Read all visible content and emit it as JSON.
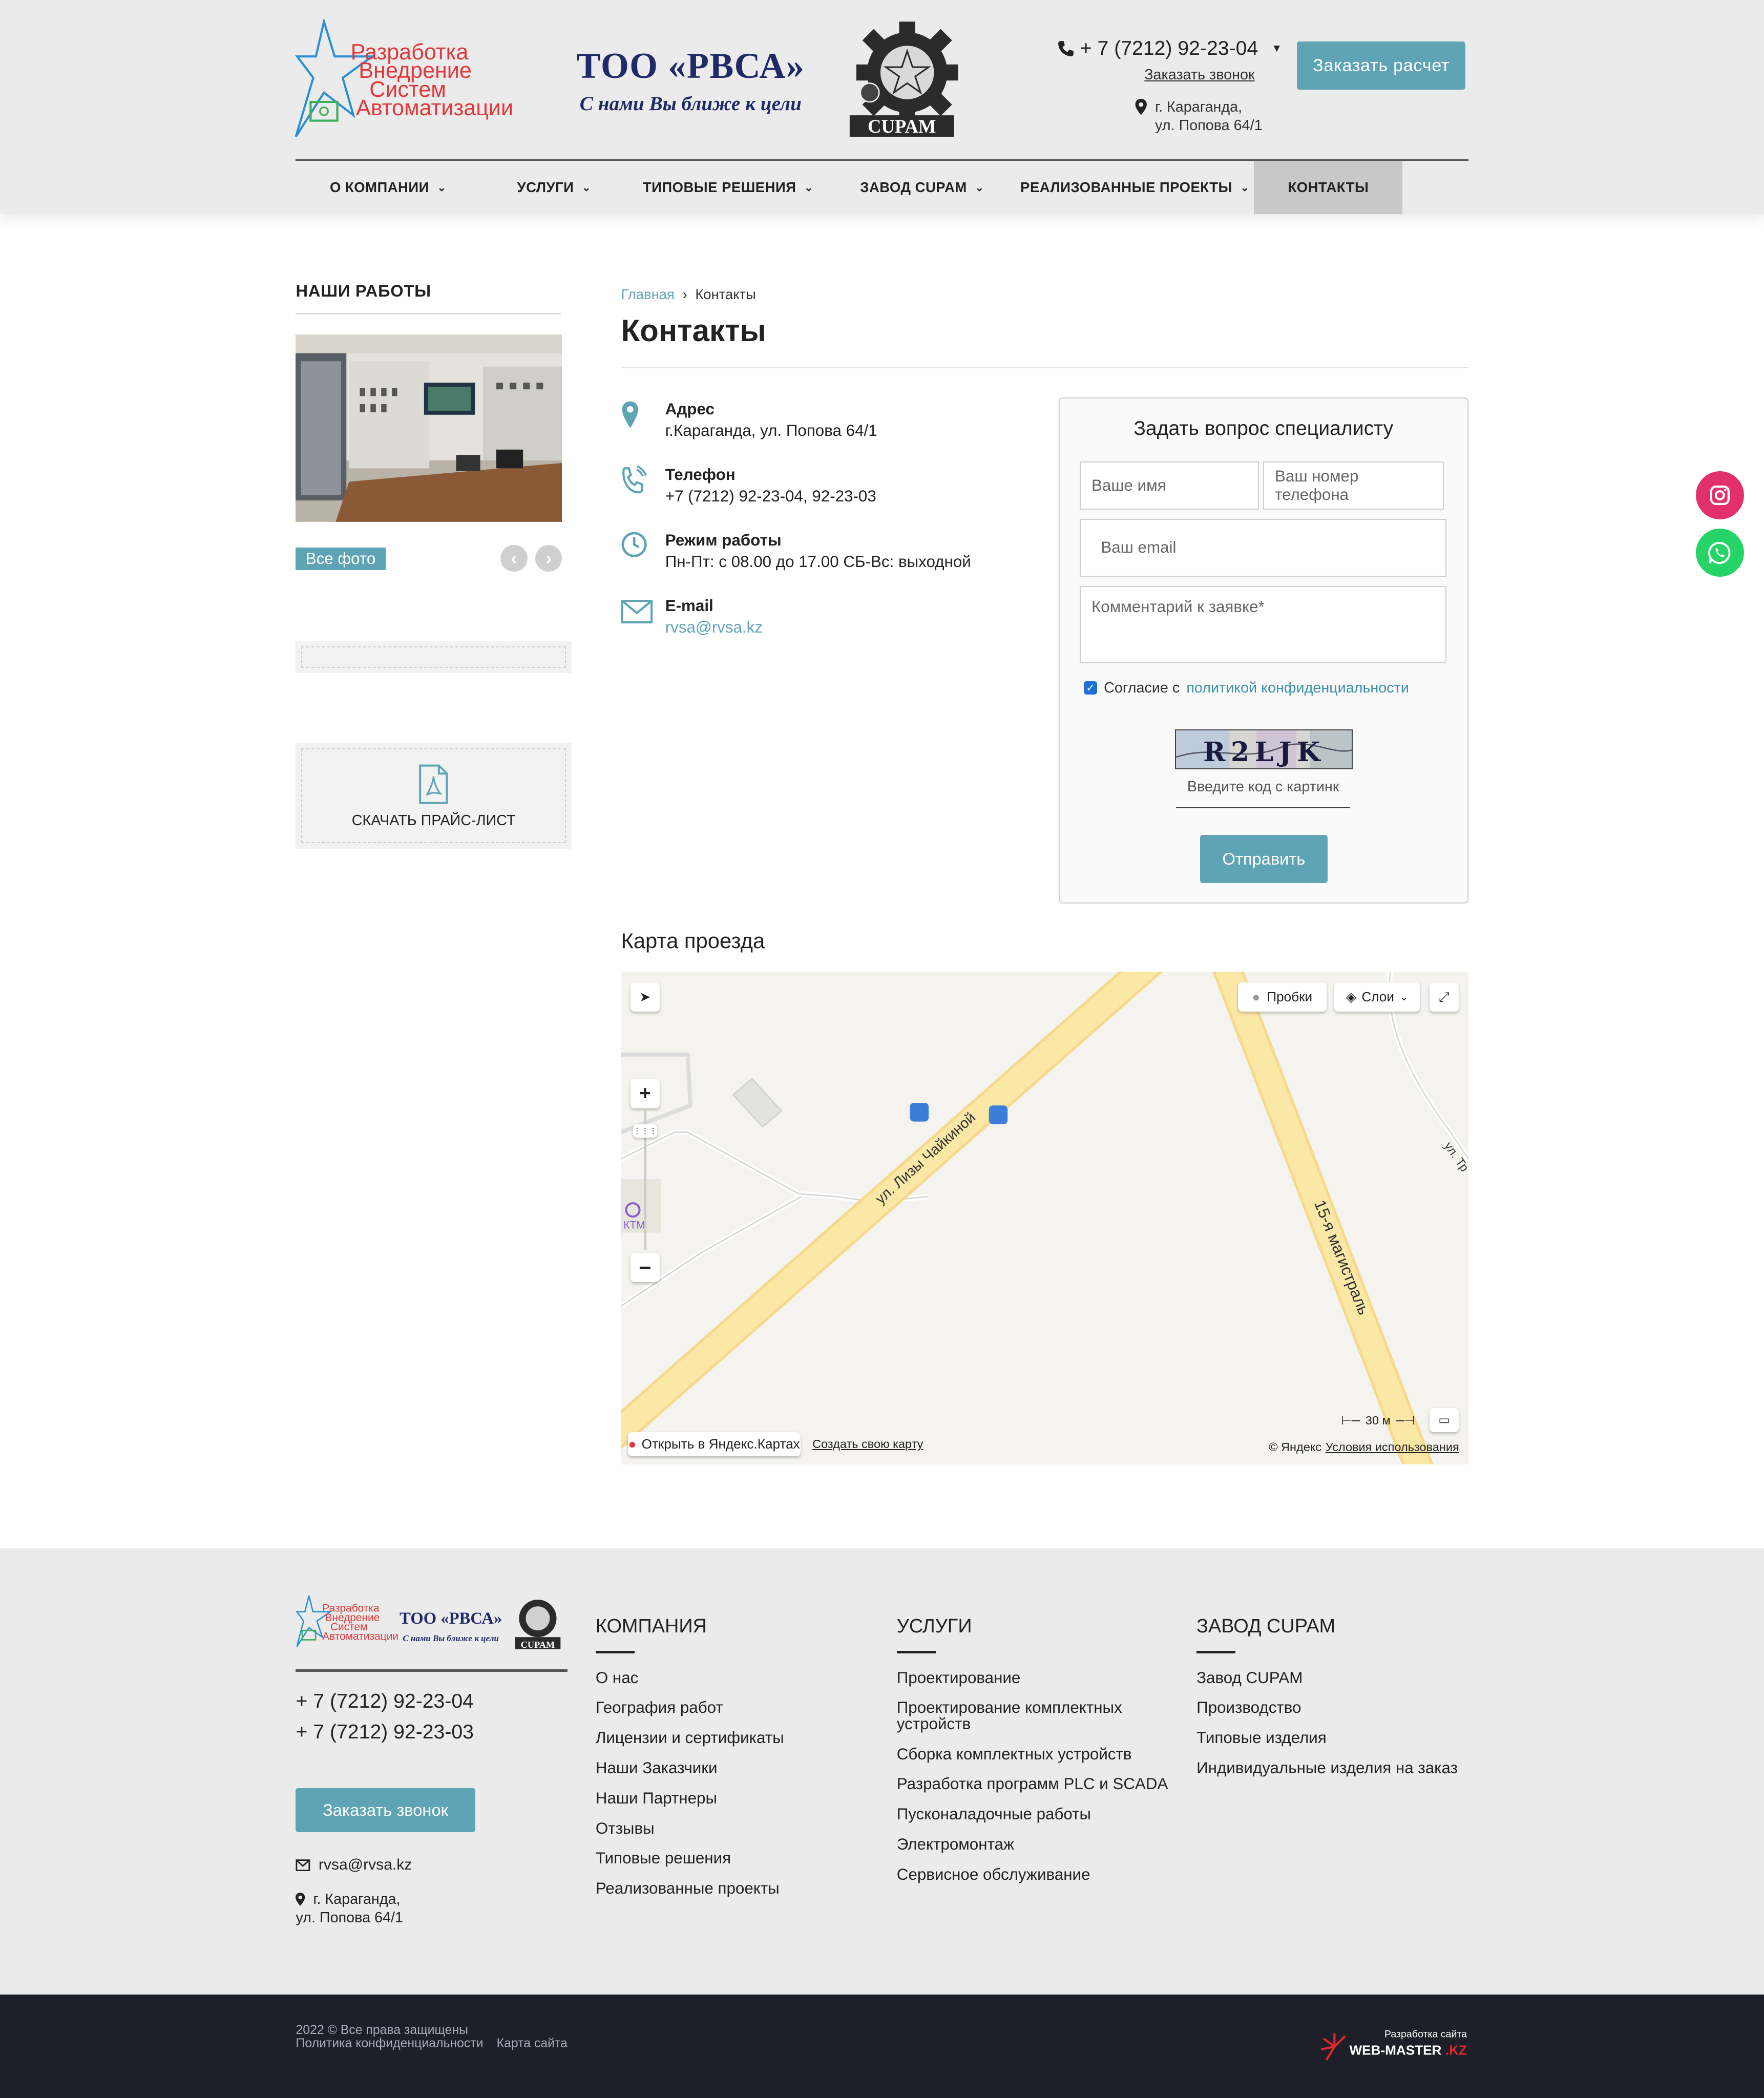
{
  "header": {
    "logo_lines": [
      "Разработка",
      "Внедрение",
      "Систем",
      "Автоматизации"
    ],
    "company_name": "ТОО «РВСА»",
    "company_slogan": "С нами Вы ближе к цели",
    "cupam_label": "CUPAM",
    "phone": "+ 7 (7212) 92-23-04",
    "callback_link": "Заказать звонок",
    "address_line1": "г. Караганда,",
    "address_line2": "ул. Попова 64/1",
    "order_button": "Заказать расчет"
  },
  "nav": [
    {
      "label": "О КОМПАНИИ",
      "has_menu": true,
      "active": false
    },
    {
      "label": "УСЛУГИ",
      "has_menu": true,
      "active": false
    },
    {
      "label": "ТИПОВЫЕ РЕШЕНИЯ",
      "has_menu": true,
      "active": false
    },
    {
      "label": "ЗАВОД CUPAM",
      "has_menu": true,
      "active": false
    },
    {
      "label": "РЕАЛИЗОВАННЫЕ ПРОЕКТЫ",
      "has_menu": true,
      "active": false
    },
    {
      "label": "КОНТАКТЫ",
      "has_menu": false,
      "active": true
    }
  ],
  "sidebar": {
    "title": "НАШИ РАБОТЫ",
    "all_photos_button": "Все фото",
    "pricelist_label": "СКАЧАТЬ ПРАЙС-ЛИСТ"
  },
  "breadcrumb": {
    "home": "Главная",
    "current": "Контакты"
  },
  "page_title": "Контакты",
  "contacts": [
    {
      "label": "Адрес",
      "value": "г.Караганда, ул. Попова 64/1",
      "icon": "location-pin-icon",
      "is_link": false
    },
    {
      "label": "Телефон",
      "value": "+7 (7212) 92-23-04, 92-23-03",
      "icon": "phone-icon",
      "is_link": false
    },
    {
      "label": "Режим работы",
      "value": "Пн-Пт: с 08.00 до 17.00 СБ-Вс: выходной",
      "icon": "clock-icon",
      "is_link": false
    },
    {
      "label": "E-mail",
      "value": "rvsa@rvsa.kz",
      "icon": "envelope-icon",
      "is_link": true
    }
  ],
  "form": {
    "title": "Задать вопрос специалисту",
    "name_placeholder": "Ваше имя",
    "phone_placeholder": "Ваш номер телефона",
    "email_placeholder": "Ваш email",
    "comment_placeholder": "Комментарий к заявке*",
    "consent_text": "Согласие с",
    "consent_link": "политикой конфиденциальности",
    "consent_checked": true,
    "captcha_text": "R2LJK",
    "captcha_placeholder": "Введите код с картинк",
    "submit": "Отправить"
  },
  "map": {
    "title": "Карта проезда",
    "traffic_button": "Пробки",
    "layers_button": "Слои",
    "street1": "ул. Лизы Чайкиной",
    "street2": "15-я магистраль",
    "street3": "ул. Тр",
    "poi": "КТМ",
    "scale": "30 м",
    "open_link": "Открыть в Яндекс.Картах",
    "create_link": "Создать свою карту",
    "copyright": "© Яндекс",
    "terms_link": "Условия использования"
  },
  "footer": {
    "company_name": "ТОО «РВСА»",
    "company_slogan": "С нами Вы ближе к цели",
    "phones": [
      "+ 7 (7212) 92-23-04",
      "+ 7 (7212) 92-23-03"
    ],
    "callback_button": "Заказать звонок",
    "email": "rvsa@rvsa.kz",
    "address_line1": "г. Караганда,",
    "address_line2": "ул. Попова 64/1",
    "columns": [
      {
        "title": "КОМПАНИЯ",
        "items": [
          "О нас",
          "География работ",
          "Лицензии и сертификаты",
          "Наши Заказчики",
          "Наши Партнеры",
          "Отзывы",
          "Типовые решения",
          "Реализованные проекты"
        ]
      },
      {
        "title": "УСЛУГИ",
        "items": [
          "Проектирование",
          "Проектирование комплектных устройств",
          "Сборка комплектных устройств",
          "Разработка программ PLC и SCADA",
          "Пусконаладочные работы",
          "Электромонтаж",
          "Сервисное обслуживание"
        ]
      },
      {
        "title": "ЗАВОД CUPAM",
        "items": [
          "Завод CUPAM",
          "Производство",
          "Типовые изделия",
          "Индивидуальные изделия на заказ"
        ]
      }
    ]
  },
  "bottom": {
    "copyright": "2022 © Все права защищены",
    "privacy_link": "Политика конфиденциальности",
    "sitemap_link": "Карта сайта",
    "dev_label": "Разработка сайта",
    "dev_brand": "WEB-MASTER",
    "dev_brand_suffix": ".KZ"
  },
  "colors": {
    "accent": "#5ea4b5",
    "navy": "#1f2a68",
    "logo_red": "#e0393b",
    "instagram": "#e1306c",
    "whatsapp": "#25d366",
    "footer_dark": "#1d2028"
  }
}
